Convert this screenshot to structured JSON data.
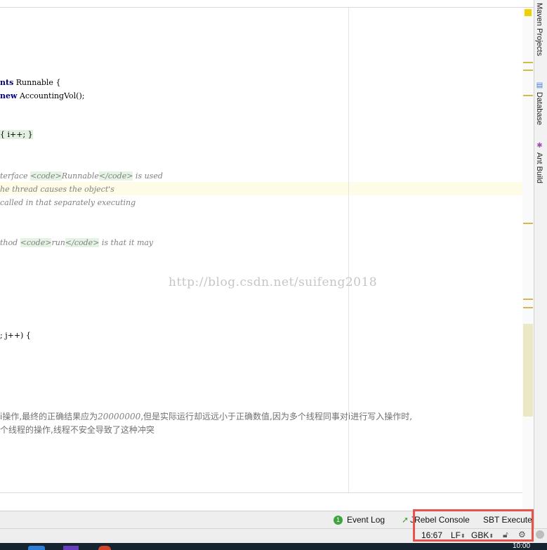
{
  "code_lines": {
    "l118": {
      "kw": "nts",
      "rest": " Runnable {"
    },
    "l137": {
      "kw": "new",
      "rest": " AccountingVol();"
    },
    "l192": {
      "text": "{ i++; }"
    },
    "l251": {
      "pre": "terface ",
      "tag1": "<code>",
      "mid": "Runnable",
      "tag2": "</code>",
      "post": " is used"
    },
    "l270": {
      "text": "he thread causes the object's"
    },
    "l289": {
      "text": "called in that separately executing"
    },
    "l346": {
      "pre": "thod ",
      "tag1": "<code>",
      "mid": "run",
      "tag2": "</code>",
      "post": " is that it may"
    },
    "l478": {
      "text": "; j++) {"
    },
    "l593": {
      "pre": "i操作,最终的正确结果应为",
      "num": "20000000",
      "post": ",但是实际运行却远远小于正确数值,因为多个线程同事对i进行写入操作时,"
    },
    "l612": {
      "text": "个线程的操作,线程不安全导致了这种冲突"
    }
  },
  "watermark": "http://blog.csdn.net/suifeng2018",
  "side_tabs": {
    "maven": "Maven Projects",
    "database": "Database",
    "ant": "Ant Build"
  },
  "tool_windows": {
    "event_log_badge": "1",
    "event_log": "Event Log",
    "jrebel": "JRebel Console",
    "sbt": "SBT Execute"
  },
  "status": {
    "caret": "16:67",
    "line_sep": "LF",
    "encoding": "GBK"
  },
  "taskbar": {
    "clock": "10:00"
  },
  "colors": {
    "keyword": "#000080",
    "comment": "#808080",
    "highlight_line": "#fefbe6",
    "annotation_box": "#e8524a",
    "marker": "#d9b845"
  }
}
